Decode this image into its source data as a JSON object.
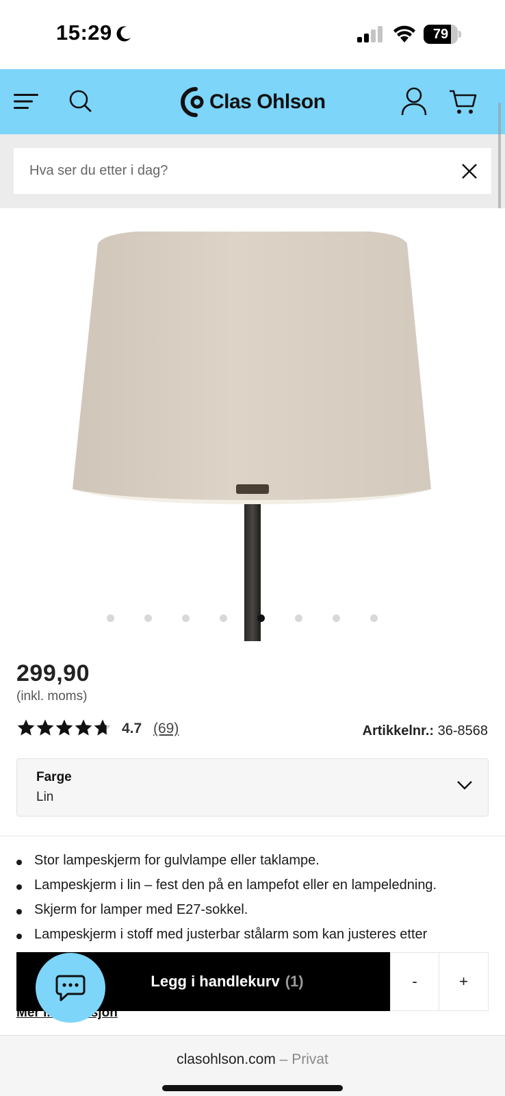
{
  "status_bar": {
    "time": "15:29",
    "battery": "79",
    "battery_level": 0.79
  },
  "header": {
    "brand": "Clas Ohlson"
  },
  "search": {
    "placeholder": "Hva ser du etter i dag?"
  },
  "gallery": {
    "total_images": 8,
    "active_index": 4
  },
  "product": {
    "price": "299,90",
    "vat_note": "(inkl. moms)",
    "rating": "4.7",
    "rating_stars": 4.7,
    "review_count": "(69)",
    "article_label": "Artikkelnr.:",
    "article_number": "36-8568"
  },
  "color_select": {
    "label": "Farge",
    "value": "Lin"
  },
  "features": [
    "Stor lampeskjerm for gulvlampe eller taklampe.",
    "Lampeskjerm i lin – fest den på en lampefot eller en lampeledning.",
    "Skjerm for lamper med E27-sokkel.",
    "Lampeskjerm i stoff med justerbar stålarm som kan justeres etter"
  ],
  "more_link": "Mer informasjon",
  "add_to_cart": {
    "label": "Legg i handlekurv",
    "quantity": "(1)",
    "minus": "-",
    "plus": "+"
  },
  "browser": {
    "domain": "clasohlson.com",
    "separator": "–",
    "mode": "Privat"
  },
  "colors": {
    "header_bg": "#7dd5fa",
    "search_area_bg": "#ececec",
    "cart_button_bg": "#000000"
  },
  "icons": [
    "moon-icon",
    "signal-icon",
    "wifi-icon",
    "battery-icon",
    "menu-icon",
    "search-icon",
    "clas-ohlson-logo-icon",
    "account-icon",
    "cart-icon",
    "close-icon",
    "star-icon",
    "chevron-down-icon",
    "chat-icon"
  ]
}
